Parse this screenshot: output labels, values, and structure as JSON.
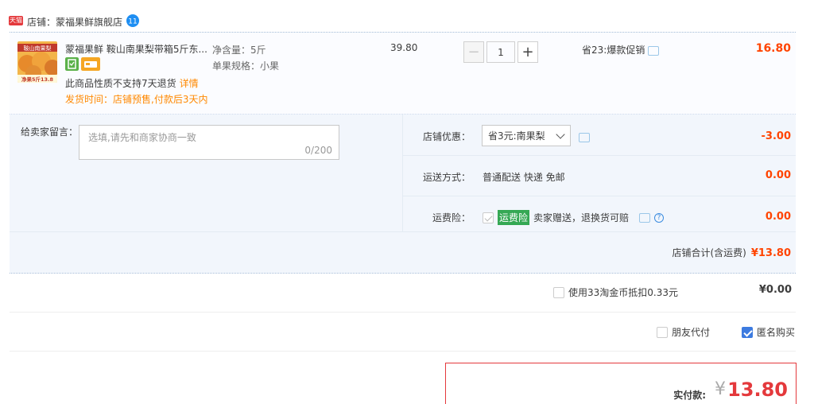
{
  "shop": {
    "badge": "天猫",
    "label": "店铺：蒙福果鲜旗舰店"
  },
  "item": {
    "thumb_text_top": "鞍山南果梨",
    "thumb_text_bottom": "净果5斤13.8",
    "title": "蒙福果鲜 鞍山南果梨带箱5斤东...",
    "sku_weight": "净含量：5斤",
    "sku_spec": "单果规格：小果",
    "price": "39.80",
    "quantity": "1",
    "qty_minus": "−",
    "qty_plus": "+",
    "promo": "省23:爆款促销",
    "subtotal": "16.80",
    "no_return": "此商品性质不支持7天退货",
    "detail_link": "详情",
    "ship_time": "发货时间：店铺预售,付款后3天内"
  },
  "message": {
    "label": "给卖家留言：",
    "placeholder": "选填,请先和商家协商一致",
    "count": "0/200"
  },
  "discount": {
    "label": "店铺优惠：",
    "selected": "省3元:南果梨",
    "value": "-3.00"
  },
  "delivery": {
    "label": "运送方式：",
    "text": "普通配送 快递 免邮",
    "value": "0.00"
  },
  "insurance": {
    "label": "运费险：",
    "tag": "运费险",
    "text": "卖家赠送，退换货可赔",
    "help": "?",
    "value": "0.00"
  },
  "shop_total": {
    "label": "店铺合计(含运费)",
    "value": "¥13.80"
  },
  "coins": {
    "label": "使用33淘金币抵扣0.33元",
    "value": "¥0.00"
  },
  "options": {
    "friend_pay": "朋友代付",
    "anonymous": "匿名购买"
  },
  "payment": {
    "label": "实付款:",
    "yen": "¥",
    "amount": "13.80"
  },
  "colors": {
    "accent_red": "#e4393c",
    "price_orange": "#ff4400",
    "notice_orange": "#ff8800",
    "insurance_green": "#35a854",
    "check_blue": "#3d7be0"
  }
}
